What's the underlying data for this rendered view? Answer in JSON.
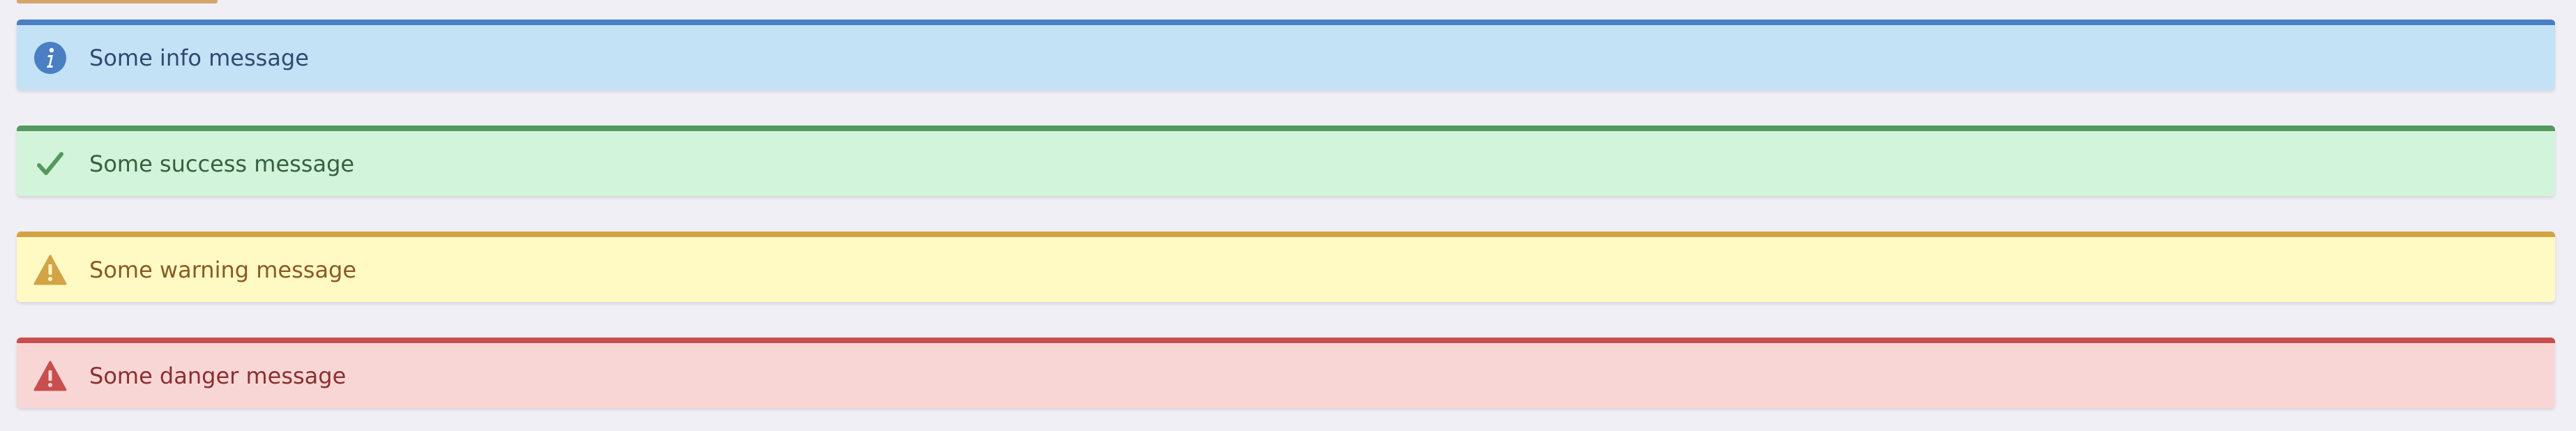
{
  "alerts": [
    {
      "type": "info",
      "icon": "info-circle-icon",
      "message": "Some info message",
      "accent": "#4a7fc4",
      "background": "#c4e2f5"
    },
    {
      "type": "success",
      "icon": "checkmark-icon",
      "message": "Some success message",
      "accent": "#55995f",
      "background": "#d2f4da"
    },
    {
      "type": "warning",
      "icon": "warning-triangle-icon",
      "message": "Some warning message",
      "accent": "#d2a446",
      "background": "#fff9c4"
    },
    {
      "type": "danger",
      "icon": "danger-triangle-icon",
      "message": "Some danger message",
      "accent": "#c94e4e",
      "background": "#f9d6d6"
    }
  ]
}
